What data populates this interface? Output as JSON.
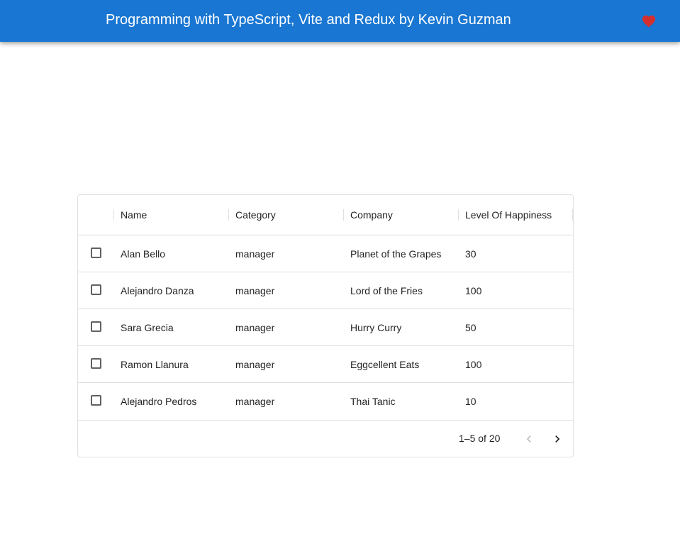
{
  "appbar": {
    "title": "Programming with TypeScript, Vite and Redux by Kevin Guzman",
    "favorite_icon": "heart-icon",
    "favorite_color": "#d32f2f",
    "background": "#1976d2"
  },
  "table": {
    "columns": [
      "Name",
      "Category",
      "Company",
      "Level Of Happiness"
    ],
    "rows": [
      {
        "name": "Alan Bello",
        "category": "manager",
        "company": "Planet of the Grapes",
        "happiness": "30"
      },
      {
        "name": "Alejandro Danza",
        "category": "manager",
        "company": "Lord of the Fries",
        "happiness": "100"
      },
      {
        "name": "Sara Grecia",
        "category": "manager",
        "company": "Hurry Curry",
        "happiness": "50"
      },
      {
        "name": "Ramon Llanura",
        "category": "manager",
        "company": "Eggcellent Eats",
        "happiness": "100"
      },
      {
        "name": "Alejandro Pedros",
        "category": "manager",
        "company": "Thai Tanic",
        "happiness": "10"
      }
    ]
  },
  "pagination": {
    "label": "1–5 of 20",
    "prev_icon": "chevron-left-icon",
    "next_icon": "chevron-right-icon"
  }
}
